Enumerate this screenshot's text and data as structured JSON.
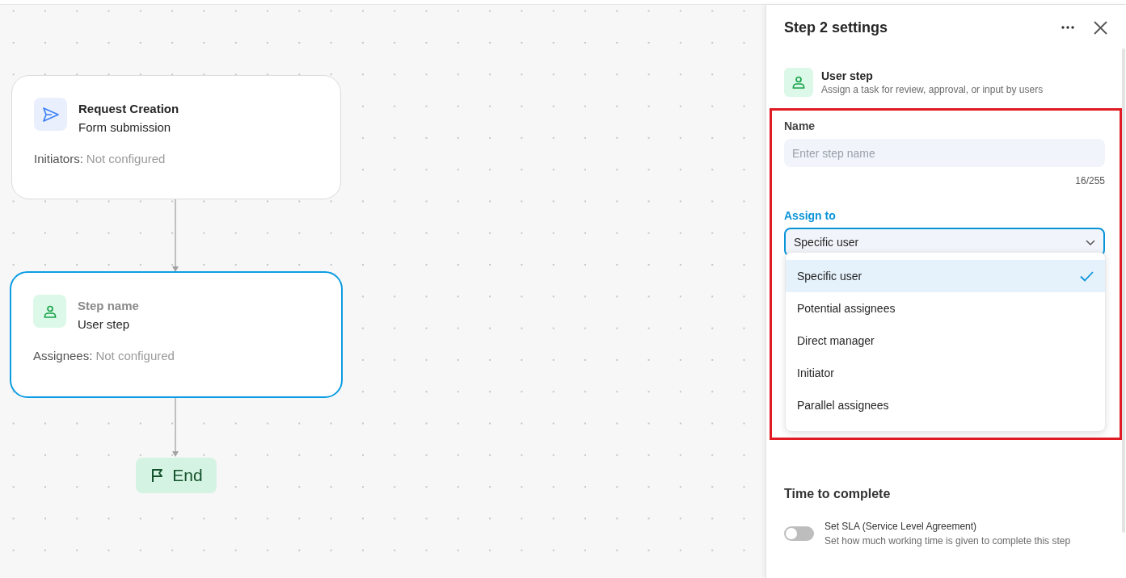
{
  "nodes": [
    {
      "kind": "trigger",
      "title": "Request Creation",
      "title_placeholder": false,
      "subtitle": "Form submission",
      "meta_label": "Initiators:",
      "meta_value": "Not configured",
      "selected": false
    },
    {
      "kind": "user",
      "title": "Step name",
      "title_placeholder": true,
      "subtitle": "User step",
      "meta_label": "Assignees:",
      "meta_value": "Not configured",
      "selected": true
    },
    {
      "kind": "end",
      "title": "End",
      "selected": false
    }
  ],
  "panel": {
    "title": "Step 2 settings",
    "step_type": {
      "title": "User step",
      "description": "Assign a task for review, approval, or input by users"
    },
    "name_field": {
      "label": "Name",
      "placeholder": "Enter step name",
      "counter": "16/255"
    },
    "assign_to": {
      "label": "Assign to",
      "value": "Specific user",
      "expanded": true,
      "options": [
        {
          "label": "Specific user",
          "selected": true
        },
        {
          "label": "Potential assignees",
          "selected": false
        },
        {
          "label": "Direct manager",
          "selected": false
        },
        {
          "label": "Initiator",
          "selected": false
        },
        {
          "label": "Parallel assignees",
          "selected": false
        }
      ]
    },
    "time_section": {
      "heading": "Time to complete",
      "sla": {
        "on": false,
        "title": "Set SLA (Service Level Agreement)",
        "description": "Set how much working time is given to complete this step"
      }
    }
  }
}
